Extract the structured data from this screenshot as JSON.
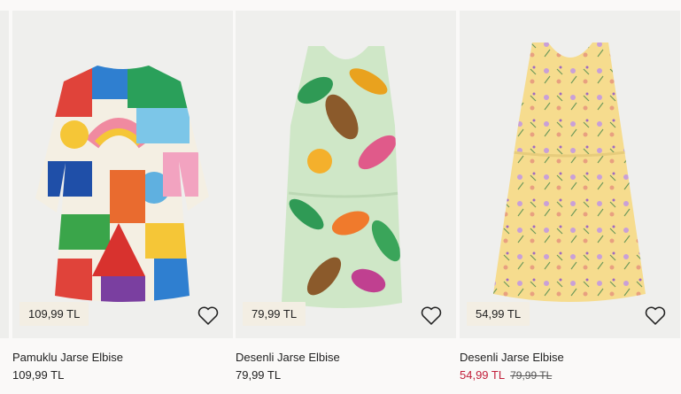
{
  "products": [
    {
      "name": "Pamuklu Jarse Elbise",
      "badge_price": "109,99 TL",
      "price": "109,99 TL"
    },
    {
      "name": "Desenli Jarse Elbise",
      "badge_price": "79,99 TL",
      "price": "79,99 TL"
    },
    {
      "name": "Desenli Jarse Elbise",
      "badge_price": "54,99 TL",
      "price": "54,99 TL",
      "old_price": "79,99 TL"
    }
  ],
  "colors": {
    "sale": "#c2203b",
    "badge_bg": "#f3eee3",
    "card_bg": "#efefed"
  },
  "icons": [
    "heart-icon"
  ]
}
